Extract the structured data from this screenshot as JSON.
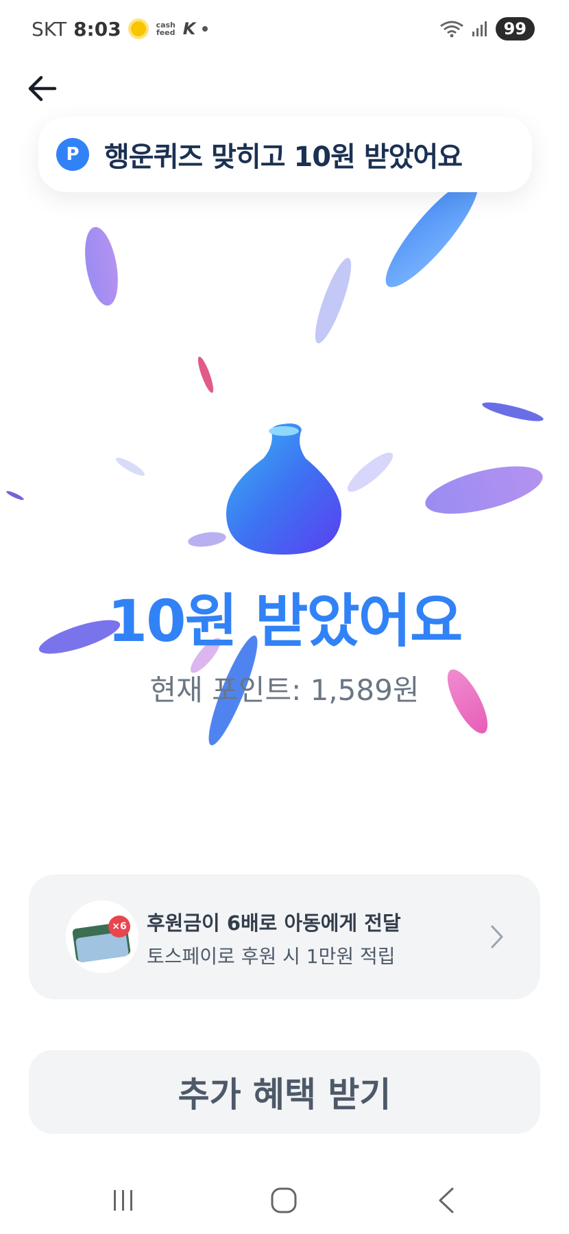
{
  "status_bar": {
    "carrier": "SKT",
    "time": "8:03",
    "notification_icons": [
      "sun-icon",
      "cashfeed-icon",
      "k-app-icon",
      "dot-icon"
    ],
    "cashfeed_label": "cash feed",
    "network_icons": [
      "wifi-icon",
      "signal-icon"
    ],
    "battery": "99"
  },
  "toast": {
    "badge": "P",
    "text": "행운퀴즈 맞히고 10원 받았어요",
    "accent_color": "#3182f6"
  },
  "result": {
    "title": "10원 받았어요",
    "points_label": "현재 포인트: 1,589원"
  },
  "promo": {
    "title": "후원금이 6배로 아동에게 전달",
    "subtitle": "토스페이로 후원 시 1만원 적립",
    "badge": "×6"
  },
  "benefit_button": {
    "label": "추가 혜택 받기"
  },
  "nav": [
    "recent-apps",
    "home",
    "back"
  ]
}
